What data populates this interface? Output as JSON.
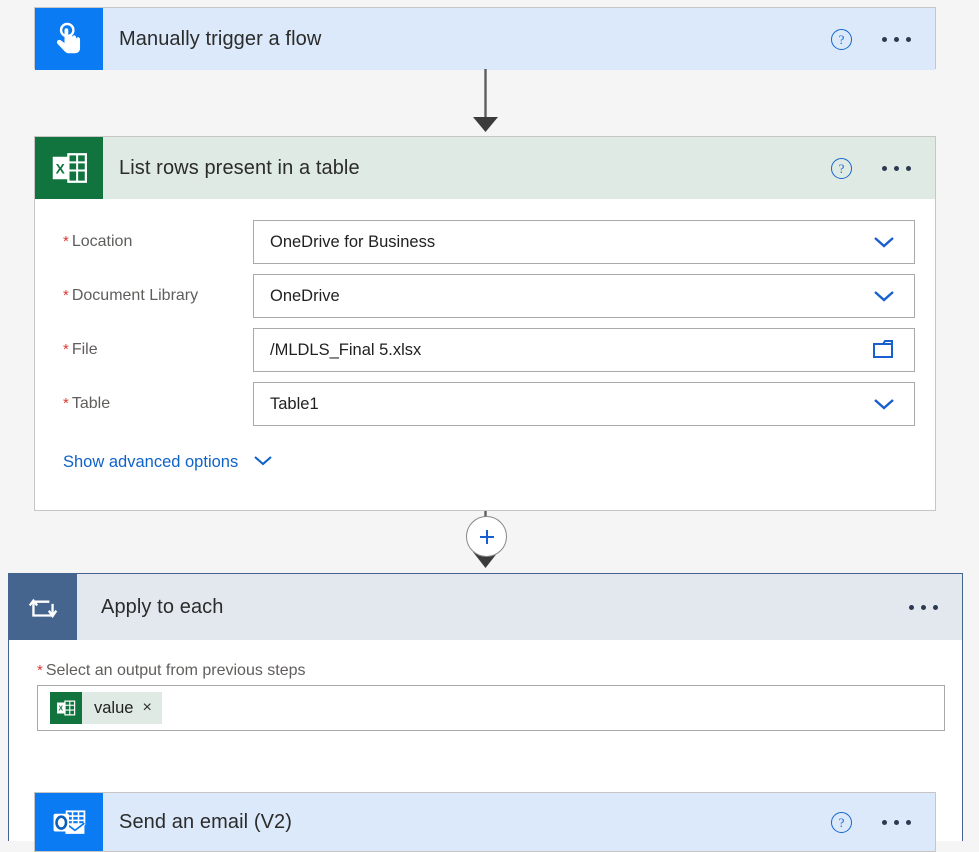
{
  "flow": {
    "trigger": {
      "title": "Manually trigger a flow",
      "icon": "hand-tap-icon",
      "accent": "#0a7bf2",
      "header_bg": "#dbe9fa",
      "help_label": "?",
      "menu_label": "More commands"
    },
    "excel_action": {
      "title": "List rows present in a table",
      "icon": "excel-icon",
      "accent": "#11743e",
      "header_bg": "#dfeae4",
      "help_label": "?",
      "fields": [
        {
          "label": "Location",
          "required": true,
          "value": "OneDrive for Business",
          "affordance": "chevron-down-icon"
        },
        {
          "label": "Document Library",
          "required": true,
          "value": "OneDrive",
          "affordance": "chevron-down-icon"
        },
        {
          "label": "File",
          "required": true,
          "value": "/MLDLS_Final 5.xlsx",
          "affordance": "folder-icon"
        },
        {
          "label": "Table",
          "required": true,
          "value": "Table1",
          "affordance": "chevron-down-icon"
        }
      ],
      "advanced_options_label": "Show advanced options"
    },
    "add_step": {
      "label": "+",
      "name": "insert-new-step-button"
    },
    "loop_action": {
      "title": "Apply to each",
      "icon": "loop-icon",
      "accent": "#45658f",
      "header_bg": "#e3e8ef",
      "output_field": {
        "label": "Select an output from previous steps",
        "required": true,
        "token": {
          "label": "value",
          "icon": "excel-icon",
          "close_label": "×"
        }
      }
    },
    "email_action": {
      "title": "Send an email (V2)",
      "icon": "outlook-icon",
      "accent": "#0a7bf2",
      "header_bg": "#dbe9fa",
      "help_label": "?"
    }
  }
}
